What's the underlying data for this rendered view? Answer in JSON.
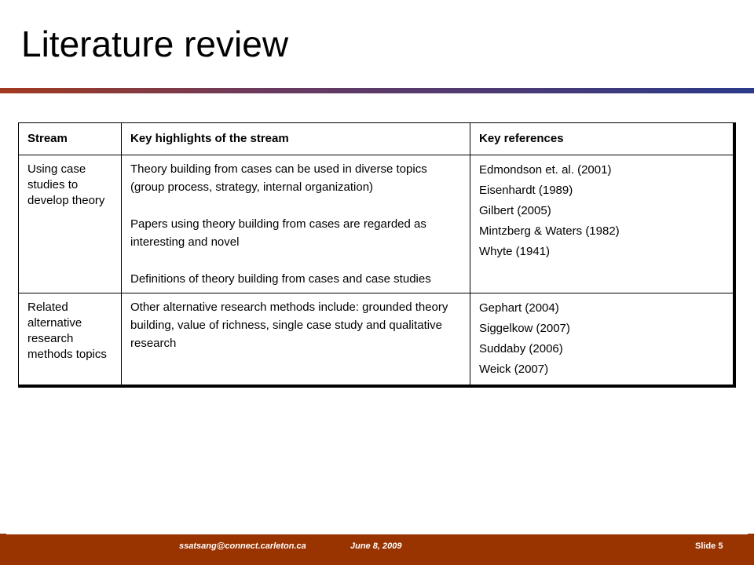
{
  "slide": {
    "title": "Literature review"
  },
  "table": {
    "headers": [
      "Stream",
      "Key highlights of the stream",
      "Key references"
    ],
    "rows": [
      {
        "stream": "Using case studies to develop theory",
        "highlights": [
          "Theory building from cases can be used in diverse topics  (group process, strategy, internal organization)",
          "Papers using theory building from cases are regarded as interesting and novel",
          "Definitions of theory building from cases and case studies"
        ],
        "references": [
          "Edmondson et. al. (2001)",
          "Eisenhardt (1989)",
          "Gilbert (2005)",
          "Mintzberg & Waters (1982)",
          "Whyte (1941)"
        ]
      },
      {
        "stream": "Related alternative research methods topics",
        "highlights": [
          "Other alternative research methods include: grounded theory building, value of richness, single case study and qualitative research"
        ],
        "references": [
          "Gephart (2004)",
          "Siggelkow (2007)",
          "Suddaby (2006)",
          "Weick (2007)"
        ]
      }
    ]
  },
  "footer": {
    "email": "ssatsang@connect.carleton.ca",
    "date": "June 8, 2009",
    "slide": "Slide 5"
  },
  "colors": {
    "footer_bar": "#993300",
    "rule_left": "#a23a1e",
    "rule_right": "#2b3a8a"
  }
}
